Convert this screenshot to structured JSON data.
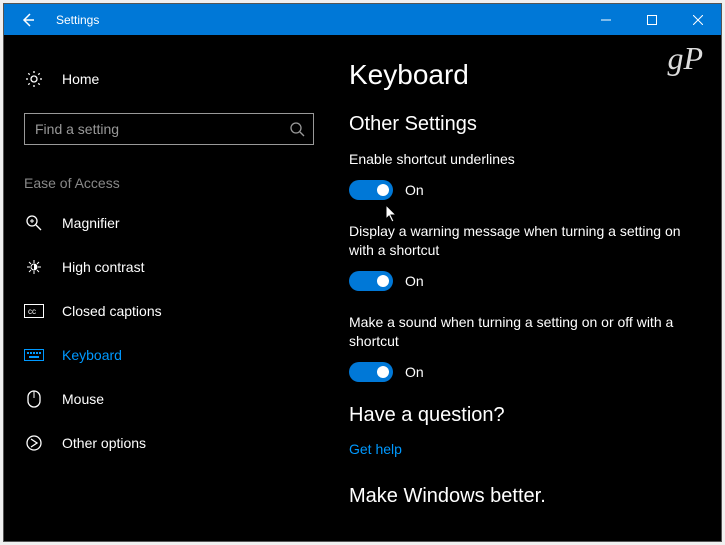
{
  "titlebar": {
    "title": "Settings"
  },
  "sidebar": {
    "home": "Home",
    "search_placeholder": "Find a setting",
    "group": "Ease of Access",
    "items": [
      {
        "label": "Magnifier"
      },
      {
        "label": "High contrast"
      },
      {
        "label": "Closed captions"
      },
      {
        "label": "Keyboard"
      },
      {
        "label": "Mouse"
      },
      {
        "label": "Other options"
      }
    ]
  },
  "main": {
    "heading": "Keyboard",
    "section": "Other Settings",
    "settings": [
      {
        "label": "Enable shortcut underlines",
        "state": "On"
      },
      {
        "label": "Display a warning message when turning a setting on with a shortcut",
        "state": "On"
      },
      {
        "label": "Make a sound when turning a setting on or off with a shortcut",
        "state": "On"
      }
    ],
    "question_heading": "Have a question?",
    "help_link": "Get help",
    "feedback_heading": "Make Windows better."
  },
  "watermark": "gP"
}
